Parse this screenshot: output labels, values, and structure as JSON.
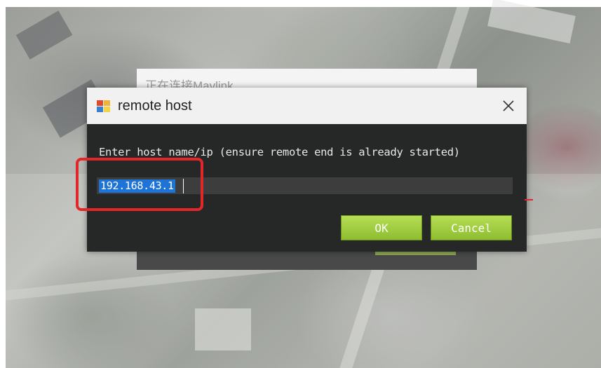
{
  "background_dialog": {
    "title": "正在连接Mavlink"
  },
  "dialog": {
    "title": "remote host",
    "prompt": "Enter host name/ip (ensure remote end is already started)",
    "host_value": "192.168.43.1",
    "buttons": {
      "ok": "OK",
      "cancel": "Cancel"
    }
  },
  "icons": [
    "app-icon",
    "close-icon"
  ],
  "colors": {
    "dialog_bg": "#262727",
    "titlebar_bg": "#f1f1f1",
    "button_green": "#9ccb3c",
    "selection_blue": "#1e74d6",
    "annotation_red": "#e2262a"
  }
}
